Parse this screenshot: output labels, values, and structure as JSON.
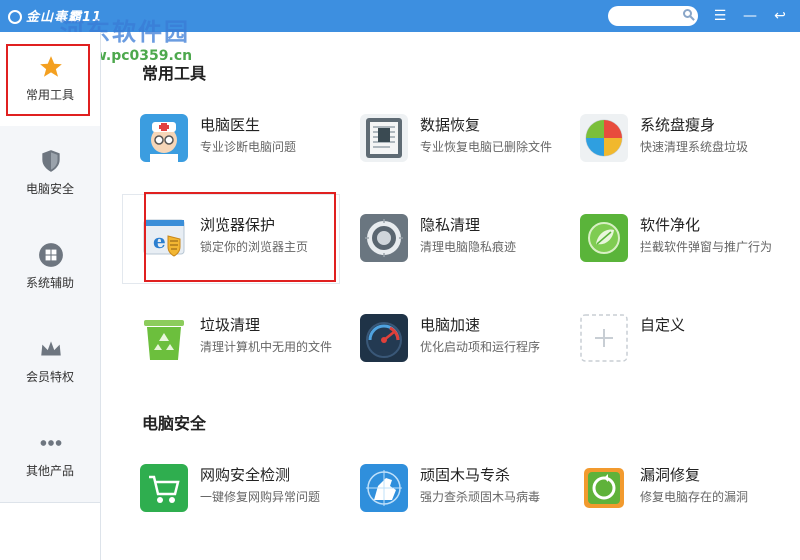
{
  "window": {
    "title": "金山毒霸11",
    "watermark": "河东软件园",
    "watermark_url": "www.pc0359.cn",
    "search_placeholder": ""
  },
  "sidebar": {
    "items": [
      {
        "label": "常用工具",
        "icon": "star-icon"
      },
      {
        "label": "电脑安全",
        "icon": "shield-icon"
      },
      {
        "label": "系统辅助",
        "icon": "windows-icon"
      },
      {
        "label": "会员特权",
        "icon": "crown-icon"
      },
      {
        "label": "其他产品",
        "icon": "more-dots-icon"
      }
    ]
  },
  "sections": [
    {
      "title": "常用工具"
    },
    {
      "title": "电脑安全"
    }
  ],
  "tools": {
    "pc_doctor": {
      "name": "电脑医生",
      "desc": "专业诊断电脑问题"
    },
    "data_recovery": {
      "name": "数据恢复",
      "desc": "专业恢复电脑已删除文件"
    },
    "disk_slim": {
      "name": "系统盘瘦身",
      "desc": "快速清理系统盘垃圾"
    },
    "browser_protect": {
      "name": "浏览器保护",
      "desc": "锁定你的浏览器主页"
    },
    "privacy_clean": {
      "name": "隐私清理",
      "desc": "清理电脑隐私痕迹"
    },
    "software_clean": {
      "name": "软件净化",
      "desc": "拦截软件弹窗与推广行为"
    },
    "junk_clean": {
      "name": "垃圾清理",
      "desc": "清理计算机中无用的文件"
    },
    "pc_speedup": {
      "name": "电脑加速",
      "desc": "优化启动项和运行程序"
    },
    "custom": {
      "name": "自定义",
      "desc": ""
    },
    "shop_check": {
      "name": "网购安全检测",
      "desc": "一键修复网购异常问题"
    },
    "trojan_kill": {
      "name": "顽固木马专杀",
      "desc": "强力查杀顽固木马病毒"
    },
    "vuln_fix": {
      "name": "漏洞修复",
      "desc": "修复电脑存在的漏洞"
    }
  },
  "colors": {
    "titlebar": "#3d8fe0",
    "highlight_border": "#e02020"
  }
}
